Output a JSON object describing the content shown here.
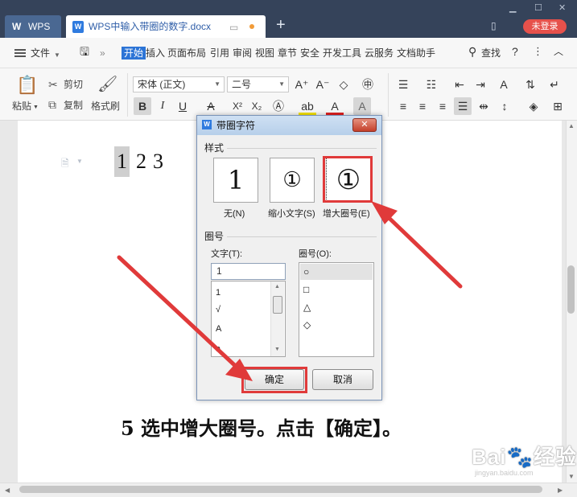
{
  "titlebar": {
    "app_tab": "WPS",
    "doc_tab": "WPS中输入带圈的数字.docx",
    "login": "未登录"
  },
  "menu": {
    "file": "文件",
    "items": [
      "开始",
      "插入",
      "页面布局",
      "引用",
      "审阅",
      "视图",
      "章节",
      "安全",
      "开发工具",
      "云服务",
      "文档助手"
    ],
    "find": "查找",
    "help": "?"
  },
  "ribbon": {
    "paste": "粘贴",
    "cut": "剪切",
    "copy": "复制",
    "format_painter": "格式刷",
    "font": "宋体 (正文)",
    "size": "二号"
  },
  "document": {
    "digits": [
      "1",
      "2",
      "3"
    ],
    "caption": "5 选中增大圈号。点击【确定】。"
  },
  "dialog": {
    "title": "带圈字符",
    "style_group": "样式",
    "styles": [
      {
        "preview": "1",
        "label": "无(N)"
      },
      {
        "preview": "①",
        "label": "缩小文字(S)"
      },
      {
        "preview": "①",
        "label": "增大圈号(E)"
      }
    ],
    "circle_group": "圈号",
    "text_label": "文字(T):",
    "text_value": "1",
    "text_list": [
      "1",
      "√",
      "A",
      "a"
    ],
    "enclosure_label": "圈号(O):",
    "enclosures": [
      "○",
      "□",
      "△",
      "◇"
    ],
    "ok": "确定",
    "cancel": "取消"
  },
  "watermark": {
    "brand": "Bai经验",
    "url": "jingyan.baidu.com"
  },
  "colors": {
    "titlebar": "#35435a",
    "accent": "#2c74d6",
    "annotation": "#e03a3a",
    "login": "#e6514b"
  }
}
